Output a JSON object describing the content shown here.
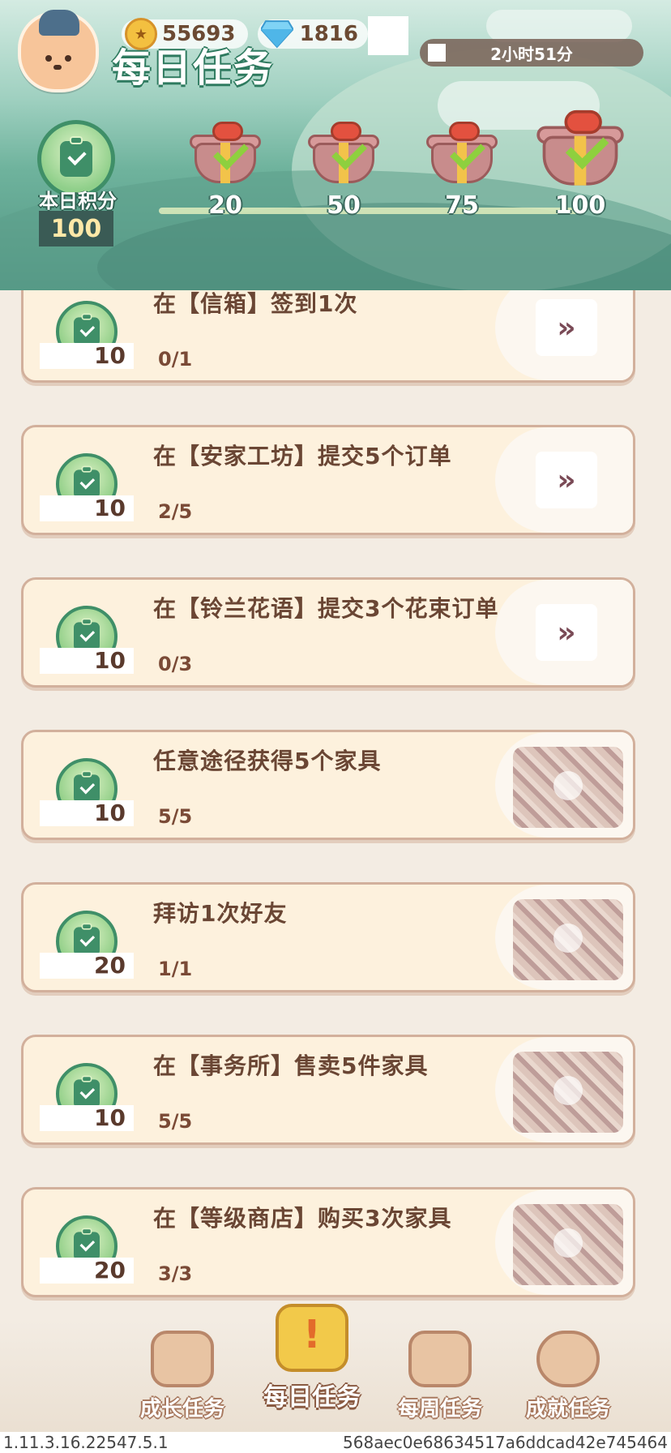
{
  "header": {
    "title": "每日任务",
    "coins": "55693",
    "gems": "1816",
    "timer": "2小时51分",
    "points_label": "本日积分",
    "points_value": "100"
  },
  "milestones": [
    {
      "value": "20",
      "claimed": true
    },
    {
      "value": "50",
      "claimed": true
    },
    {
      "value": "75",
      "claimed": true
    },
    {
      "value": "100",
      "claimed": true
    }
  ],
  "tasks": [
    {
      "title": "在【信箱】签到1次",
      "reward": "10",
      "progress": "0/1",
      "status": "go"
    },
    {
      "title": "在【安家工坊】提交5个订单",
      "reward": "10",
      "progress": "2/5",
      "status": "go"
    },
    {
      "title": "在【铃兰花语】提交3个花束订单",
      "reward": "10",
      "progress": "0/3",
      "status": "go"
    },
    {
      "title": "任意途径获得5个家具",
      "reward": "10",
      "progress": "5/5",
      "status": "done"
    },
    {
      "title": "拜访1次好友",
      "reward": "20",
      "progress": "1/1",
      "status": "done"
    },
    {
      "title": "在【事务所】售卖5件家具",
      "reward": "10",
      "progress": "5/5",
      "status": "done"
    },
    {
      "title": "在【等级商店】购买3次家具",
      "reward": "20",
      "progress": "3/3",
      "status": "done"
    }
  ],
  "nav": {
    "growth": "成长任务",
    "daily": "每日任务",
    "weekly": "每周任务",
    "achievement": "成就任务"
  },
  "footer": {
    "version": "1.11.3.16.22547.5.1",
    "hash": "568aec0e68634517a6ddcad42e745464"
  },
  "colors": {
    "accent_green": "#3f8f68",
    "card_bg": "#fdf1dd",
    "text_brown": "#6a4634"
  }
}
